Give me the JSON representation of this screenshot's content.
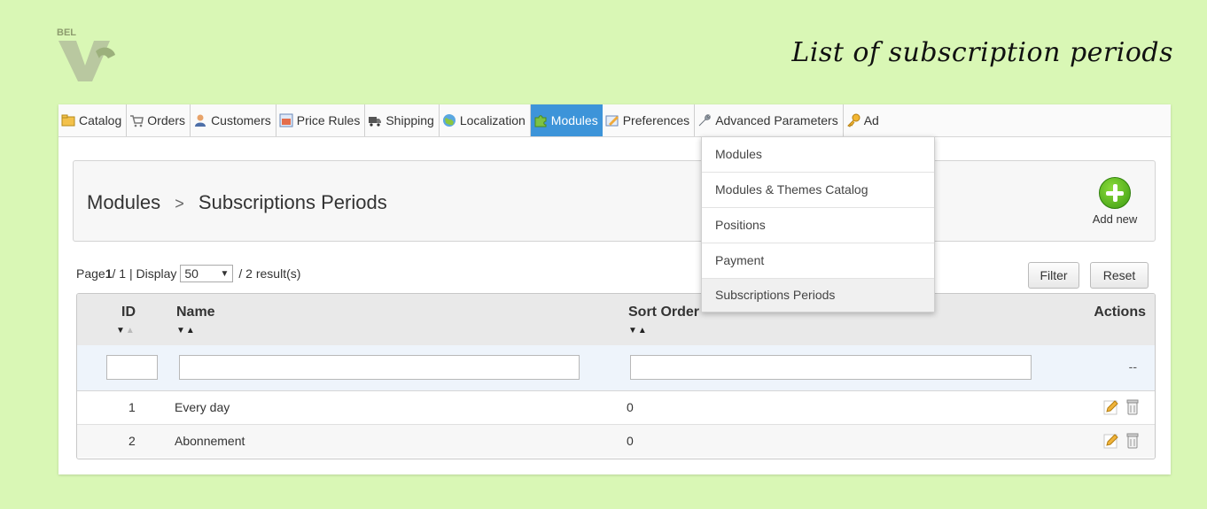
{
  "page": {
    "title": "List of subscription periods"
  },
  "nav": {
    "items": [
      {
        "label": "Catalog",
        "icon": "folder-icon"
      },
      {
        "label": "Orders",
        "icon": "cart-icon"
      },
      {
        "label": "Customers",
        "icon": "user-icon"
      },
      {
        "label": "Price Rules",
        "icon": "price-tag-icon"
      },
      {
        "label": "Shipping",
        "icon": "truck-icon"
      },
      {
        "label": "Localization",
        "icon": "globe-icon"
      },
      {
        "label": "Modules",
        "icon": "puzzle-icon",
        "active": true
      },
      {
        "label": "Preferences",
        "icon": "preferences-icon"
      },
      {
        "label": "Advanced Parameters",
        "icon": "wrench-icon"
      },
      {
        "label": "Ad",
        "icon": "key-icon"
      }
    ]
  },
  "dropdown": {
    "items": [
      "Modules",
      "Modules & Themes Catalog",
      "Positions",
      "Payment",
      "Subscriptions Periods"
    ],
    "selected": "Subscriptions Periods"
  },
  "breadcrumb": {
    "parent": "Modules",
    "separator": ">",
    "current": "Subscriptions Periods"
  },
  "add_new_label": "Add new",
  "pagination": {
    "page_prefix": "Page ",
    "page_current": "1",
    "page_total": " / 1 | Display",
    "display_value": "50",
    "results": "/ 2 result(s)"
  },
  "buttons": {
    "filter": "Filter",
    "reset": "Reset"
  },
  "table": {
    "columns": {
      "id": "ID",
      "name": "Name",
      "sort_order": "Sort Order",
      "actions": "Actions"
    },
    "filter_actions": "--",
    "rows": [
      {
        "id": "1",
        "name": "Every day",
        "sort_order": "0"
      },
      {
        "id": "2",
        "name": "Abonnement",
        "sort_order": "0"
      }
    ]
  },
  "colors": {
    "background": "#d9f7b5",
    "accent": "#3d94d9",
    "add_new": "#4caf1b"
  }
}
